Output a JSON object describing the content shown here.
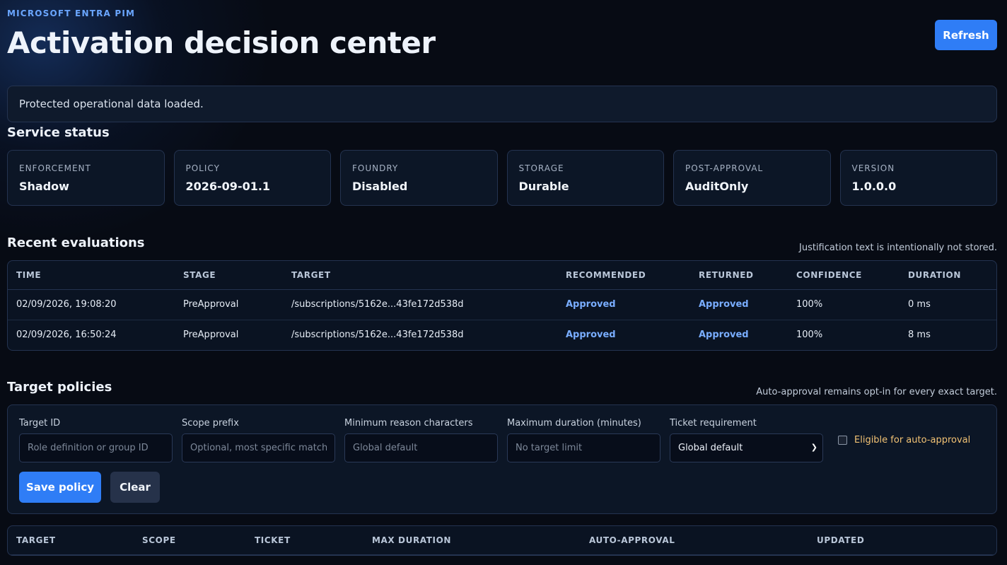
{
  "header": {
    "eyebrow": "MICROSOFT ENTRA PIM",
    "title": "Activation decision center",
    "refresh_label": "Refresh"
  },
  "notice": "Protected operational data loaded.",
  "service_status": {
    "title": "Service status",
    "cards": [
      {
        "label": "ENFORCEMENT",
        "value": "Shadow"
      },
      {
        "label": "POLICY",
        "value": "2026-09-01.1"
      },
      {
        "label": "FOUNDRY",
        "value": "Disabled"
      },
      {
        "label": "STORAGE",
        "value": "Durable"
      },
      {
        "label": "POST-APPROVAL",
        "value": "AuditOnly"
      },
      {
        "label": "VERSION",
        "value": "1.0.0.0"
      }
    ]
  },
  "evaluations": {
    "title": "Recent evaluations",
    "note": "Justification text is intentionally not stored.",
    "columns": [
      "TIME",
      "STAGE",
      "TARGET",
      "RECOMMENDED",
      "RETURNED",
      "CONFIDENCE",
      "DURATION"
    ],
    "rows": [
      {
        "time": "02/09/2026, 19:08:20",
        "stage": "PreApproval",
        "target": "/subscriptions/5162e...43fe172d538d",
        "recommended": "Approved",
        "returned": "Approved",
        "confidence": "100%",
        "duration": "0 ms"
      },
      {
        "time": "02/09/2026, 16:50:24",
        "stage": "PreApproval",
        "target": "/subscriptions/5162e...43fe172d538d",
        "recommended": "Approved",
        "returned": "Approved",
        "confidence": "100%",
        "duration": "8 ms"
      }
    ]
  },
  "policies": {
    "title": "Target policies",
    "note": "Auto-approval remains opt-in for every exact target.",
    "form": {
      "target_id_label": "Target ID",
      "target_id_placeholder": "Role definition or group ID",
      "scope_label": "Scope prefix",
      "scope_placeholder": "Optional, most specific match wins",
      "min_reason_label": "Minimum reason characters",
      "min_reason_placeholder": "Global default",
      "max_duration_label": "Maximum duration (minutes)",
      "max_duration_placeholder": "No target limit",
      "ticket_label": "Ticket requirement",
      "ticket_selected": "Global default",
      "auto_approval_label": "Eligible for auto-approval",
      "save_label": "Save policy",
      "clear_label": "Clear"
    },
    "columns": [
      "TARGET",
      "SCOPE",
      "TICKET",
      "MAX DURATION",
      "AUTO-APPROVAL",
      "UPDATED"
    ]
  }
}
